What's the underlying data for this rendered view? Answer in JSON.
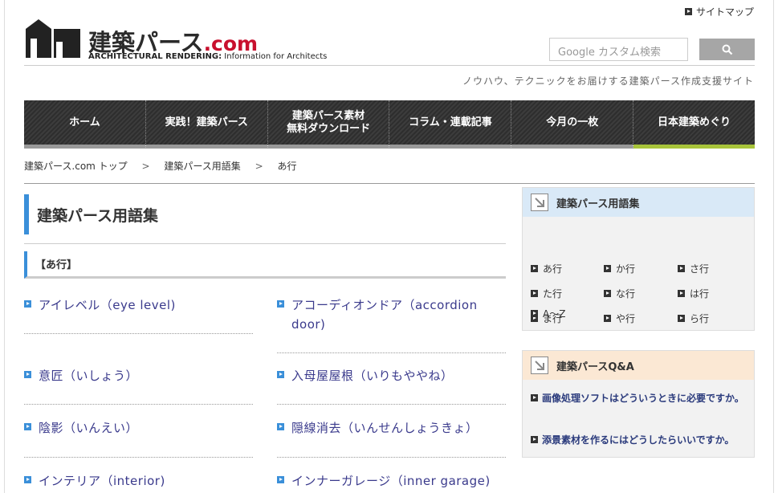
{
  "header": {
    "sitemap_label": "サイトマップ",
    "logo_main": "建築パース",
    "logo_com": ".com",
    "logo_sub_bold": "ARCHITECTURAL RENDERING:",
    "logo_sub_rest": " Information for Architects",
    "search_placeholder": "Google カスタム検索",
    "tagline": "ノウハウ、テクニックをお届けする建築パース作成支援サイト"
  },
  "nav": {
    "items": [
      {
        "label": "ホーム"
      },
      {
        "label": "実践！建築パース"
      },
      {
        "label": "建築パース素材\n無料ダウンロード"
      },
      {
        "label": "コラム・連載記事"
      },
      {
        "label": "今月の一枚"
      },
      {
        "label": "日本建築めぐり"
      }
    ]
  },
  "breadcrumb": {
    "items": [
      "建築パース.com トップ",
      "建築パース用語集",
      "あ行"
    ],
    "separator": ">"
  },
  "main": {
    "page_title": "建築パース用語集",
    "section_title": "【あ行】",
    "terms": [
      {
        "label": "アイレベル（eye level)"
      },
      {
        "label": "アコーディオンドア（accordion door)"
      },
      {
        "label": "意匠（いしょう）"
      },
      {
        "label": "入母屋屋根（いりもややね）"
      },
      {
        "label": "陰影（いんえい）"
      },
      {
        "label": "隠線消去（いんせんしょうきょ）"
      },
      {
        "label": "インテリア（interior)"
      },
      {
        "label": "インナーガレージ（inner garage)"
      }
    ]
  },
  "sidebar": {
    "glossary": {
      "title": "建築パース用語集",
      "items": [
        "あ行",
        "か行",
        "さ行",
        "た行",
        "な行",
        "は行",
        "ま行",
        "や行",
        "ら行",
        "A～Z"
      ]
    },
    "qa": {
      "title": "建築パースQ&A",
      "items": [
        "画像処理ソフトはどういうときに必要ですか。",
        "添景素材を作るにはどうしたらいいですか。"
      ]
    }
  },
  "colors": {
    "accent_blue": "#3a8fd9",
    "logo_red": "#c8102e",
    "nav_active": "#a8c43a"
  }
}
